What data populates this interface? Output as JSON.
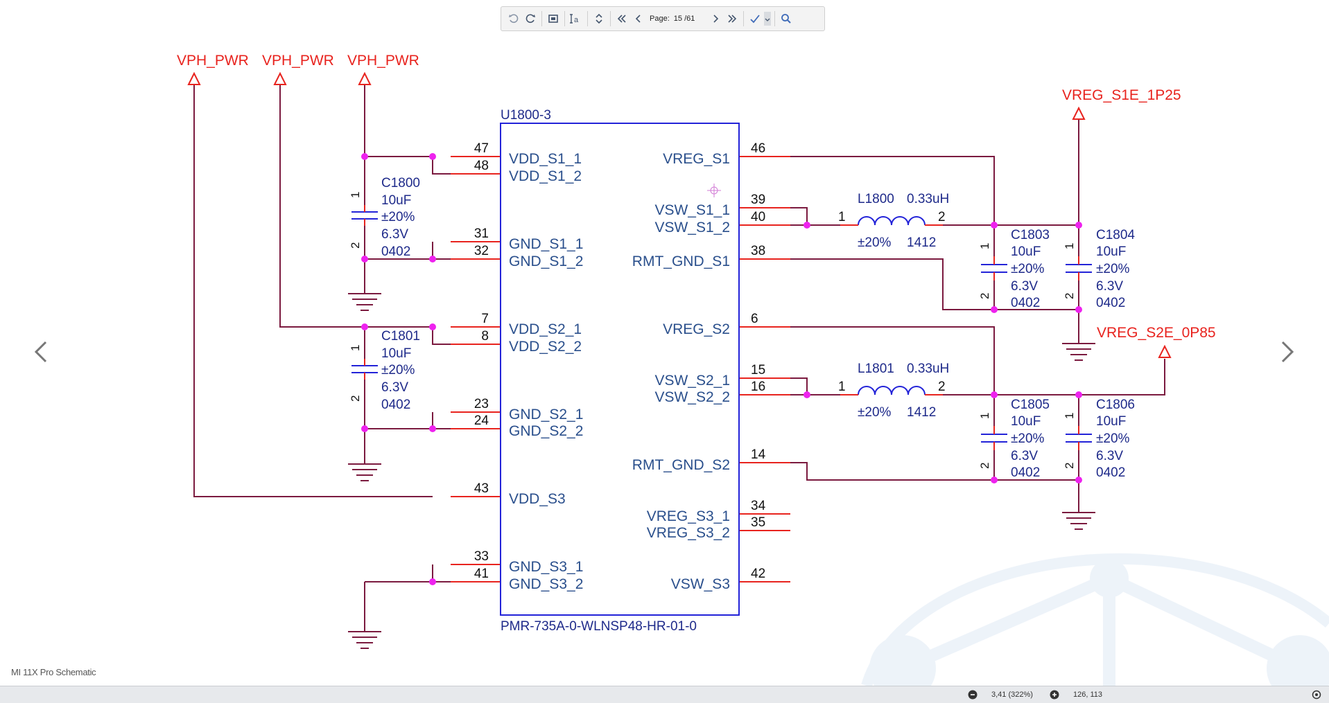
{
  "document": {
    "title": "MI 11X Pro Schematic"
  },
  "toolbar": {
    "page_label": "Page:",
    "page_current": "15",
    "page_total": "/61",
    "icons": [
      "rotate-left-icon",
      "rotate-right-icon",
      "fit-page-icon",
      "text-select-icon",
      "scroll-mode-icon",
      "first-page-icon",
      "previous-page-icon",
      "next-page-icon",
      "last-page-icon",
      "annotate-icon",
      "search-icon"
    ]
  },
  "status": {
    "zoom": "3,41 (322%)",
    "coords": "126, 113"
  },
  "schematic": {
    "part_ref": "U1800-3",
    "part_name": "PMR-735A-0-WLNSP48-HR-01-0",
    "power_labels": {
      "vph1": "VPH_PWR",
      "vph2": "VPH_PWR",
      "vph3": "VPH_PWR",
      "vreg_s1e": "VREG_S1E_1P25",
      "vreg_s2e": "VREG_S2E_0P85"
    },
    "left_pins": [
      {
        "num": "47",
        "name": "VDD_S1_1"
      },
      {
        "num": "48",
        "name": "VDD_S1_2"
      },
      {
        "num": "31",
        "name": "GND_S1_1"
      },
      {
        "num": "32",
        "name": "GND_S1_2"
      },
      {
        "num": "7",
        "name": "VDD_S2_1"
      },
      {
        "num": "8",
        "name": "VDD_S2_2"
      },
      {
        "num": "23",
        "name": "GND_S2_1"
      },
      {
        "num": "24",
        "name": "GND_S2_2"
      },
      {
        "num": "43",
        "name": "VDD_S3"
      },
      {
        "num": "33",
        "name": "GND_S3_1"
      },
      {
        "num": "41",
        "name": "GND_S3_2"
      }
    ],
    "right_pins": [
      {
        "num": "46",
        "name": "VREG_S1"
      },
      {
        "num": "39",
        "name": "VSW_S1_1"
      },
      {
        "num": "40",
        "name": "VSW_S1_2"
      },
      {
        "num": "38",
        "name": "RMT_GND_S1"
      },
      {
        "num": "6",
        "name": "VREG_S2"
      },
      {
        "num": "15",
        "name": "VSW_S2_1"
      },
      {
        "num": "16",
        "name": "VSW_S2_2"
      },
      {
        "num": "14",
        "name": "RMT_GND_S2"
      },
      {
        "num": "34",
        "name": "VREG_S3_1"
      },
      {
        "num": "35",
        "name": "VREG_S3_2"
      },
      {
        "num": "42",
        "name": "VSW_S3"
      }
    ],
    "capacitors": [
      {
        "ref": "C1800",
        "value": "10uF",
        "tol": "±20%",
        "voltage": "6.3V",
        "pkg": "0402",
        "pin1": "1",
        "pin2": "2"
      },
      {
        "ref": "C1801",
        "value": "10uF",
        "tol": "±20%",
        "voltage": "6.3V",
        "pkg": "0402",
        "pin1": "1",
        "pin2": "2"
      },
      {
        "ref": "C1803",
        "value": "10uF",
        "tol": "±20%",
        "voltage": "6.3V",
        "pkg": "0402",
        "pin1": "1",
        "pin2": "2"
      },
      {
        "ref": "C1804",
        "value": "10uF",
        "tol": "±20%",
        "voltage": "6.3V",
        "pkg": "0402",
        "pin1": "1",
        "pin2": "2"
      },
      {
        "ref": "C1805",
        "value": "10uF",
        "tol": "±20%",
        "voltage": "6.3V",
        "pkg": "0402",
        "pin1": "1",
        "pin2": "2"
      },
      {
        "ref": "C1806",
        "value": "10uF",
        "tol": "±20%",
        "voltage": "6.3V",
        "pkg": "0402",
        "pin1": "1",
        "pin2": "2"
      }
    ],
    "inductors": [
      {
        "ref": "L1800",
        "value": "0.33uH",
        "tol": "±20%",
        "pkg": "1412",
        "pin1": "1",
        "pin2": "2"
      },
      {
        "ref": "L1801",
        "value": "0.33uH",
        "tol": "±20%",
        "pkg": "1412",
        "pin1": "1",
        "pin2": "2"
      }
    ]
  },
  "colors": {
    "wire": "#7b1a3f",
    "pin": "#e8231e",
    "body": "#2323d8",
    "text": "#1e2a8a",
    "net_label": "#e8231e",
    "junction": "#ee22ee",
    "pin_name": "#2a4f8c"
  }
}
